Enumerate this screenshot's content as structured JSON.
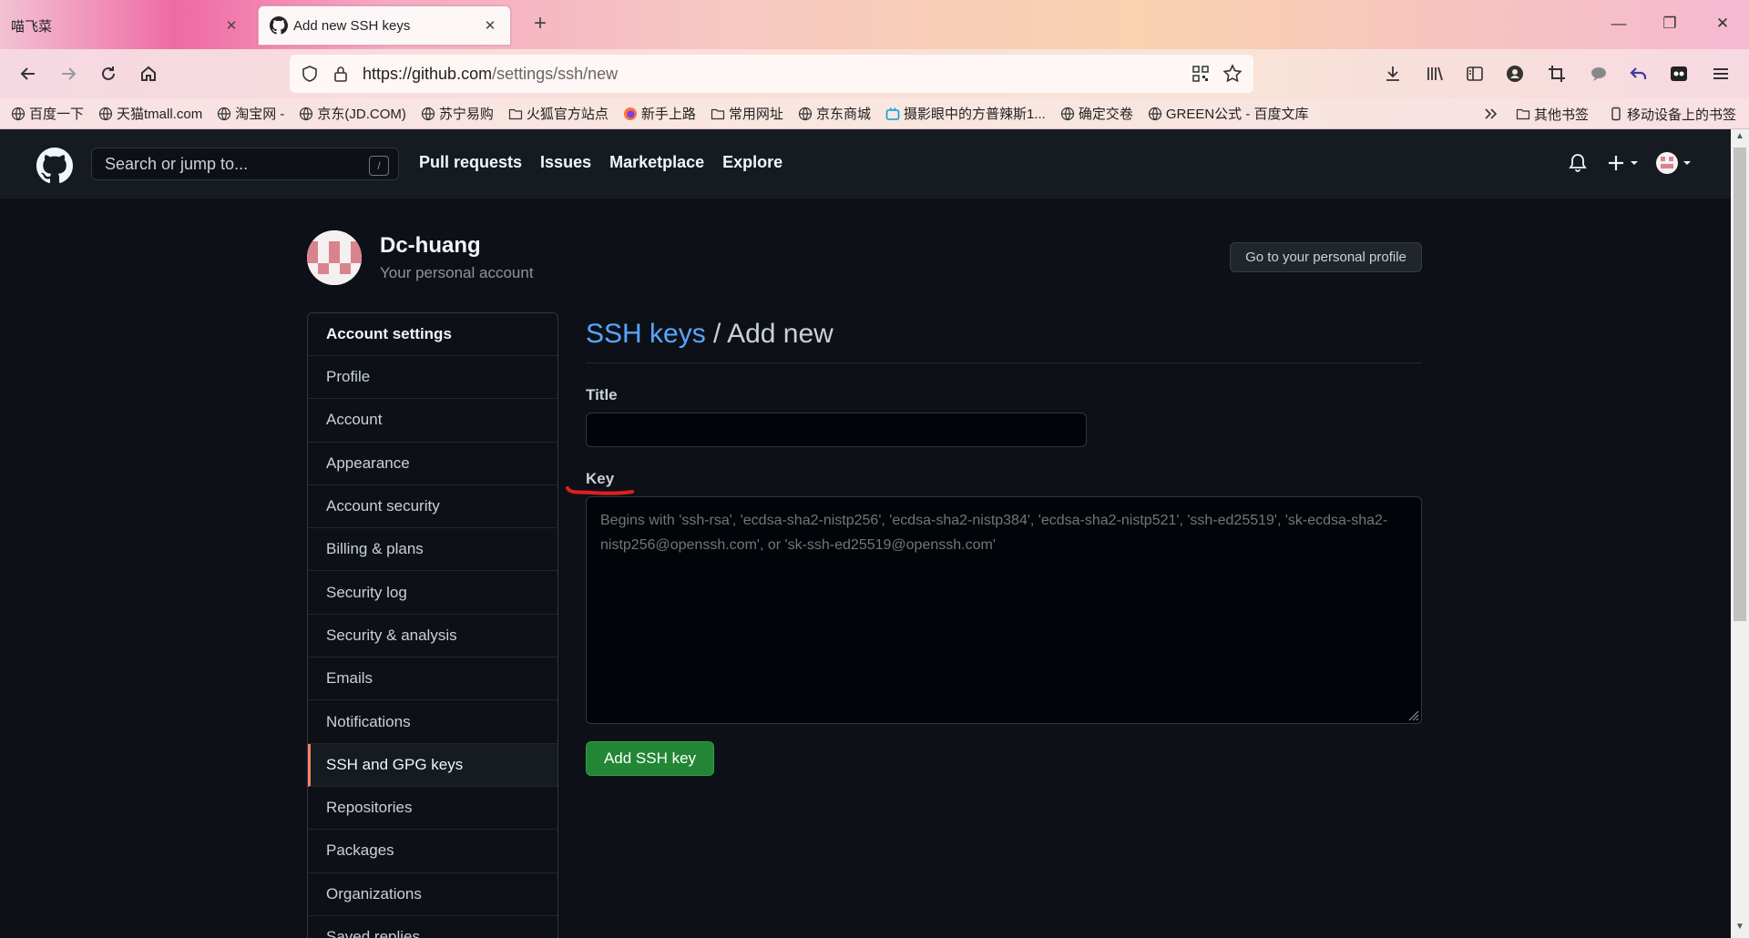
{
  "browser": {
    "tabs": [
      {
        "label": "喵飞菜",
        "active": false
      },
      {
        "label": "Add new SSH keys",
        "active": true
      }
    ],
    "url_host": "https://github.com",
    "url_path": "/settings/ssh/new",
    "bookmarks": [
      "百度一下",
      "天猫tmall.com",
      "淘宝网 -",
      "京东(JD.COM)",
      "苏宁易购",
      "火狐官方站点",
      "新手上路",
      "常用网址",
      "京东商城",
      "摄影眼中的方普辣斯1...",
      "确定交卷",
      "GREEN公式 - 百度文库"
    ],
    "bookmarks_right": [
      "其他书签",
      "移动设备上的书签"
    ]
  },
  "github": {
    "search_placeholder": "Search or jump to...",
    "search_key": "/",
    "nav": [
      "Pull requests",
      "Issues",
      "Marketplace",
      "Explore"
    ]
  },
  "account": {
    "name": "Dc-huang",
    "subtitle": "Your personal account",
    "profile_button": "Go to your personal profile"
  },
  "menu": {
    "header": "Account settings",
    "items": [
      {
        "label": "Profile"
      },
      {
        "label": "Account"
      },
      {
        "label": "Appearance"
      },
      {
        "label": "Account security"
      },
      {
        "label": "Billing & plans"
      },
      {
        "label": "Security log"
      },
      {
        "label": "Security & analysis"
      },
      {
        "label": "Emails"
      },
      {
        "label": "Notifications"
      },
      {
        "label": "SSH and GPG keys",
        "selected": true
      },
      {
        "label": "Repositories"
      },
      {
        "label": "Packages"
      },
      {
        "label": "Organizations"
      },
      {
        "label": "Saved replies"
      }
    ]
  },
  "form": {
    "title_link": "SSH keys",
    "title_sep": " / ",
    "title_rest": "Add new",
    "title_label": "Title",
    "title_value": "",
    "key_label": "Key",
    "key_placeholder": "Begins with 'ssh-rsa', 'ecdsa-sha2-nistp256', 'ecdsa-sha2-nistp384', 'ecdsa-sha2-nistp521', 'ssh-ed25519', 'sk-ecdsa-sha2-nistp256@openssh.com', or 'sk-ssh-ed25519@openssh.com'",
    "submit": "Add SSH key"
  },
  "colors": {
    "accent_link": "#58a6ff",
    "primary_button": "#238636",
    "selected_marker": "#f78166",
    "annotation_red": "#e0201e"
  }
}
